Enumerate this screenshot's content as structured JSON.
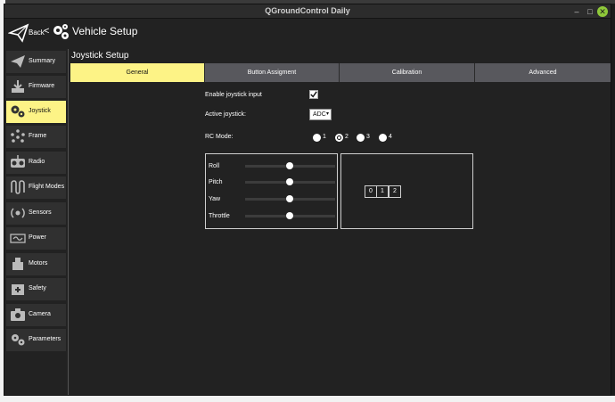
{
  "window": {
    "title": "QGroundControl Daily"
  },
  "toolbar": {
    "back_label": "Back",
    "separator": "<",
    "page_title": "Vehicle Setup"
  },
  "sidebar": {
    "items": [
      {
        "label": "Summary",
        "icon": "plane-icon"
      },
      {
        "label": "Firmware",
        "icon": "download-icon"
      },
      {
        "label": "Joystick",
        "icon": "gears-icon",
        "active": true
      },
      {
        "label": "Frame",
        "icon": "frame-icon"
      },
      {
        "label": "Radio",
        "icon": "radio-icon"
      },
      {
        "label": "Flight Modes",
        "icon": "flight-modes-icon"
      },
      {
        "label": "Sensors",
        "icon": "sensors-icon"
      },
      {
        "label": "Power",
        "icon": "power-icon"
      },
      {
        "label": "Motors",
        "icon": "motors-icon"
      },
      {
        "label": "Safety",
        "icon": "safety-icon"
      },
      {
        "label": "Camera",
        "icon": "camera-icon"
      },
      {
        "label": "Parameters",
        "icon": "parameters-icon"
      }
    ]
  },
  "main": {
    "section_title": "Joystick Setup",
    "tabs": [
      "General",
      "Button Assigment",
      "Calibration",
      "Advanced"
    ],
    "active_tab": "General",
    "enable_label": "Enable joystick input",
    "enable_checked": true,
    "active_joystick_label": "Active joystick:",
    "active_joystick_value": "ADC",
    "rc_mode_label": "RC Mode:",
    "rc_modes": [
      "1",
      "2",
      "3",
      "4"
    ],
    "rc_mode_selected": "2",
    "axes": [
      {
        "label": "Roll"
      },
      {
        "label": "Pitch"
      },
      {
        "label": "Yaw"
      },
      {
        "label": "Throttle"
      }
    ],
    "buttons": [
      "0",
      "1",
      "2"
    ]
  },
  "colors": {
    "accent": "#fdf386",
    "tab_inactive": "#58585d",
    "background": "#222222",
    "sidebar_item": "#303030"
  }
}
